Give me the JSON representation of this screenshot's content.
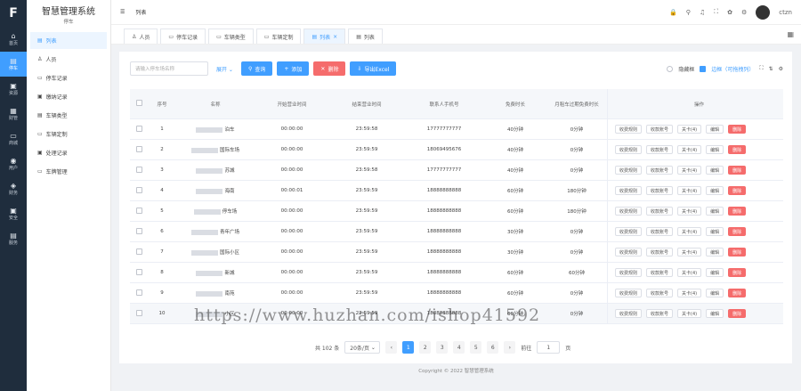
{
  "app": {
    "logo": "F",
    "title": "智慧管理系统",
    "subtitle": "停车"
  },
  "rail": [
    {
      "icon": "⌂",
      "label": "首页"
    },
    {
      "icon": "▤",
      "label": "停车"
    },
    {
      "icon": "▣",
      "label": "资源"
    },
    {
      "icon": "▦",
      "label": "财管"
    },
    {
      "icon": "▭",
      "label": "商城"
    },
    {
      "icon": "◉",
      "label": "用户"
    },
    {
      "icon": "◈",
      "label": "财务"
    },
    {
      "icon": "▣",
      "label": "安全"
    },
    {
      "icon": "▤",
      "label": "服务"
    }
  ],
  "menu": [
    {
      "icon": "▤",
      "label": "列表"
    },
    {
      "icon": "♙",
      "label": "人员"
    },
    {
      "icon": "▭",
      "label": "停车记录"
    },
    {
      "icon": "▣",
      "label": "缴纳记录"
    },
    {
      "icon": "▤",
      "label": "车辆类型"
    },
    {
      "icon": "▭",
      "label": "车辆定制"
    },
    {
      "icon": "▣",
      "label": "处理记录"
    },
    {
      "icon": "▭",
      "label": "车牌管理"
    }
  ],
  "topbar": {
    "crumb": "列表",
    "user": "ctzn"
  },
  "tabs": [
    {
      "icon": "♙",
      "label": "人员"
    },
    {
      "icon": "▭",
      "label": "停车记录"
    },
    {
      "icon": "▭",
      "label": "车辆类型"
    },
    {
      "icon": "▭",
      "label": "车辆定制"
    },
    {
      "icon": "▤",
      "label": "列表"
    },
    {
      "icon": "▤",
      "label": "列表"
    }
  ],
  "toolbar": {
    "search_placeholder": "请输入停车场名称",
    "expand": "展开",
    "search": "查询",
    "add": "添加",
    "delete": "删除",
    "export": "导出Excel",
    "opt1": "隐藏框",
    "opt2": "边框（可拖拽列）"
  },
  "table": {
    "headers": [
      "序号",
      "名称",
      "开始营业时间",
      "结束营业时间",
      "联系人手机号",
      "免费时长",
      "月租车过期免费时长",
      "操作"
    ],
    "op_labels": [
      "收费规则",
      "收款账号",
      "关卡",
      "编辑",
      "删除"
    ],
    "rows": [
      [
        "1",
        "泊车",
        "00:00:00",
        "23:59:58",
        "17777777777",
        "40分钟",
        "0分钟",
        "关卡(4)"
      ],
      [
        "2",
        "国际车场",
        "00:00:00",
        "23:59:59",
        "18069495676",
        "40分钟",
        "0分钟",
        "关卡(4)"
      ],
      [
        "3",
        "苏城",
        "00:00:00",
        "23:59:58",
        "17777777777",
        "40分钟",
        "0分钟",
        "关卡(4)"
      ],
      [
        "4",
        "海南",
        "00:00:01",
        "23:59:59",
        "18888888888",
        "60分钟",
        "180分钟",
        "关卡(4)"
      ],
      [
        "5",
        "停车场",
        "00:00:00",
        "23:59:59",
        "18888888888",
        "60分钟",
        "180分钟",
        "关卡(4)"
      ],
      [
        "6",
        "青年广场",
        "00:00:00",
        "23:59:59",
        "18888888888",
        "30分钟",
        "0分钟",
        "关卡(4)"
      ],
      [
        "7",
        "国际小区",
        "00:00:00",
        "23:59:59",
        "18888888888",
        "30分钟",
        "0分钟",
        "关卡(4)"
      ],
      [
        "8",
        "新城",
        "00:00:00",
        "23:59:59",
        "18888888888",
        "60分钟",
        "60分钟",
        "关卡(4)"
      ],
      [
        "9",
        "南苑",
        "00:00:00",
        "23:59:59",
        "18888888888",
        "60分钟",
        "0分钟",
        "关卡(4)"
      ],
      [
        "10",
        "小区",
        "00:00:00",
        "23:59:59",
        "18888888888",
        "60分钟",
        "0分钟",
        "关卡(4)"
      ]
    ]
  },
  "pager": {
    "total": "共 102 条",
    "size": "20条/页",
    "pages": [
      "1",
      "2",
      "3",
      "4",
      "5",
      "6"
    ],
    "jump_label": "前往",
    "jump_value": "1",
    "jump_unit": "页"
  },
  "footer": "Copyright © 2022 智慧管理系统",
  "watermark": "https://www.huzhan.com/ishop41592"
}
